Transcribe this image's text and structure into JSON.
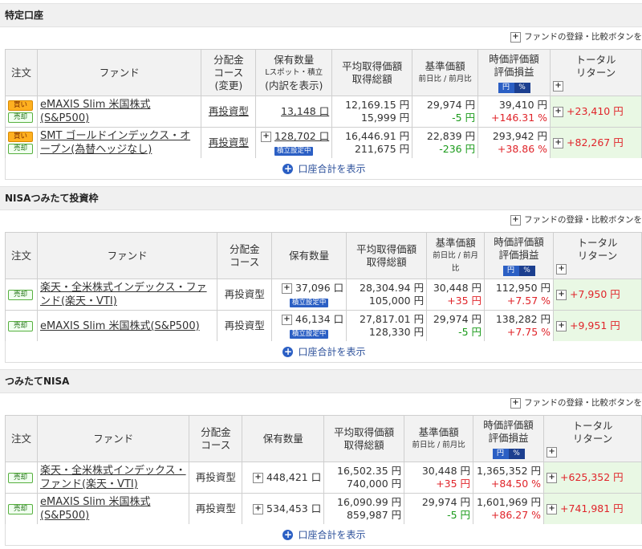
{
  "common": {
    "toolbar_label": "ファンドの登録・比較ボタンを",
    "show_total": "口座合計を表示",
    "total_header": "トータル\nリターン",
    "buy": "買い",
    "sell": "売却",
    "tsumi_badge": "積立設定中",
    "pct_toggle": [
      "円",
      "%"
    ],
    "price_sub": "前日比 / 前月比"
  },
  "sections": [
    {
      "title": "特定口座",
      "headers": {
        "order": "注文",
        "fund": "ファンド",
        "course": "分配金\nコース\n(変更)",
        "holding": "保有数量",
        "holding_sub": "Lスポット・積立",
        "holding_link": "(内訳を表示)",
        "avg": "平均取得価額\n取得総額",
        "price": "基準価額",
        "val": "時価評価額\n評価損益"
      },
      "rows": [
        {
          "fund": "eMAXIS Slim 米国株式(S&P500)",
          "course": "再投資型",
          "qty": "13,148 口",
          "avg": "12,169.15 円",
          "total_cost": "15,999 円",
          "price": "29,974 円",
          "price_change": "-5 円",
          "value": "39,410 円",
          "gain": "+146.31 %",
          "total_return": "+23,410 円",
          "buy": true
        },
        {
          "fund": "SMT ゴールドインデックス・オープン(為替ヘッジなし)",
          "course": "再投資型",
          "qty": "128,702 口",
          "avg": "16,446.91 円",
          "total_cost": "211,675 円",
          "price": "22,839 円",
          "price_change": "-236 円",
          "value": "293,942 円",
          "gain": "+38.86 %",
          "total_return": "+82,267 円",
          "buy": true
        }
      ]
    },
    {
      "title": "NISAつみたて投資枠",
      "headers": {
        "order": "注文",
        "fund": "ファンド",
        "course": "分配金\nコース",
        "holding": "保有数量",
        "avg": "平均取得価額\n取得総額",
        "price": "基準価額",
        "val": "時価評価額\n評価損益"
      },
      "rows": [
        {
          "fund": "楽天・全米株式インデックス・ファンド(楽天・VTI)",
          "course": "再投資型",
          "qty": "37,096 口",
          "avg": "28,304.94 円",
          "total_cost": "105,000 円",
          "price": "30,448 円",
          "price_change": "+35 円",
          "value": "112,950 円",
          "gain": "+7.57 %",
          "total_return": "+7,950 円"
        },
        {
          "fund": "eMAXIS Slim 米国株式(S&P500)",
          "course": "再投資型",
          "qty": "46,134 口",
          "avg": "27,817.01 円",
          "total_cost": "128,330 円",
          "price": "29,974 円",
          "price_change": "-5 円",
          "value": "138,282 円",
          "gain": "+7.75 %",
          "total_return": "+9,951 円"
        }
      ]
    },
    {
      "title": "つみたてNISA",
      "headers": {
        "order": "注文",
        "fund": "ファンド",
        "course": "分配金\nコース",
        "holding": "保有数量",
        "avg": "平均取得価額\n取得総額",
        "price": "基準価額",
        "val": "時価評価額\n評価損益"
      },
      "rows": [
        {
          "fund": "楽天・全米株式インデックス・ファンド(楽天・VTI)",
          "course": "再投資型",
          "qty": "448,421 口",
          "avg": "16,502.35 円",
          "total_cost": "740,000 円",
          "price": "30,448 円",
          "price_change": "+35 円",
          "value": "1,365,352 円",
          "gain": "+84.50 %",
          "total_return": "+625,352 円"
        },
        {
          "fund": "eMAXIS Slim 米国株式(S&P500)",
          "course": "再投資型",
          "qty": "534,453 口",
          "avg": "16,090.99 円",
          "total_cost": "859,987 円",
          "price": "29,974 円",
          "price_change": "-5 円",
          "value": "1,601,969 円",
          "gain": "+86.27 %",
          "total_return": "+741,981 円"
        }
      ]
    }
  ],
  "colors": {
    "positive": "#e0242a",
    "negative": "#1a9a1a",
    "accent": "#2b5fc4",
    "total_bg": "#e9f8e4"
  }
}
